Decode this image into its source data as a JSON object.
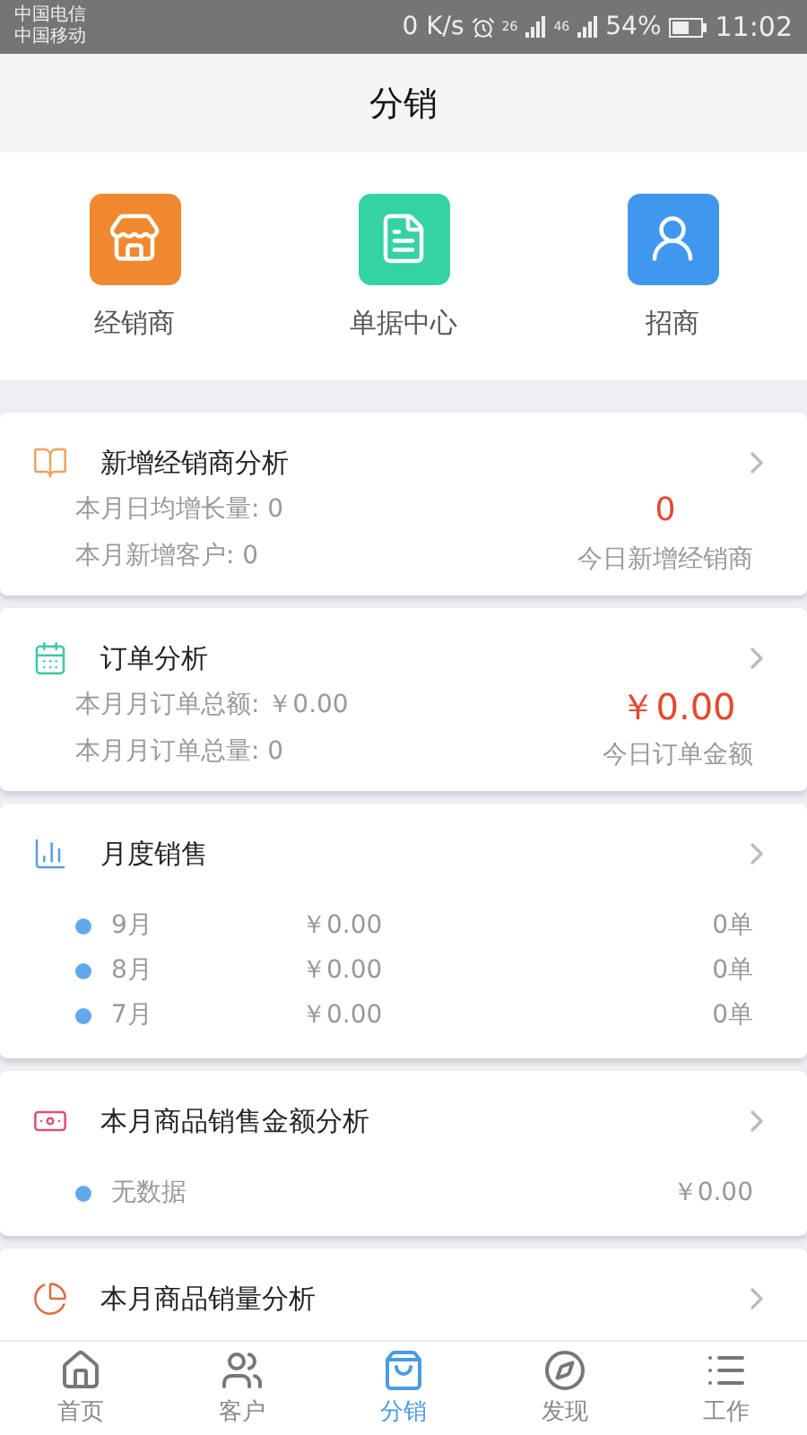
{
  "status_bar": {
    "carriers": [
      "中国电信",
      "中国移动"
    ],
    "speed": "0 K/s",
    "sim1": "26",
    "sim2": "46",
    "battery": "54%",
    "time": "11:02"
  },
  "title": "分销",
  "shortcuts": [
    {
      "label": "经销商"
    },
    {
      "label": "单据中心"
    },
    {
      "label": "招商"
    }
  ],
  "cards": [
    {
      "kind": "stats",
      "title": "新增经销商分析",
      "lines": [
        "本月日均增长量: 0",
        "本月新增客户: 0"
      ],
      "value": "0",
      "caption": "今日新增经销商"
    },
    {
      "kind": "stats",
      "title": "订单分析",
      "lines": [
        "本月月订单总额: ￥0.00",
        "本月月订单总量: 0"
      ],
      "value": "￥0.00",
      "caption": "今日订单金额"
    },
    {
      "kind": "list",
      "title": "月度销售",
      "rows": [
        {
          "name": "9月",
          "amount": "￥0.00",
          "count": "0单"
        },
        {
          "name": "8月",
          "amount": "￥0.00",
          "count": "0单"
        },
        {
          "name": "7月",
          "amount": "￥0.00",
          "count": "0单"
        }
      ]
    },
    {
      "kind": "list",
      "title": "本月商品销售金额分析",
      "rows": [
        {
          "name": "无数据",
          "count": "￥0.00"
        }
      ]
    },
    {
      "kind": "header",
      "title": "本月商品销量分析"
    }
  ],
  "tabs": [
    {
      "label": "首页",
      "selected": false
    },
    {
      "label": "客户",
      "selected": false
    },
    {
      "label": "分销",
      "selected": true
    },
    {
      "label": "发现",
      "selected": false
    },
    {
      "label": "工作",
      "selected": false
    }
  ]
}
